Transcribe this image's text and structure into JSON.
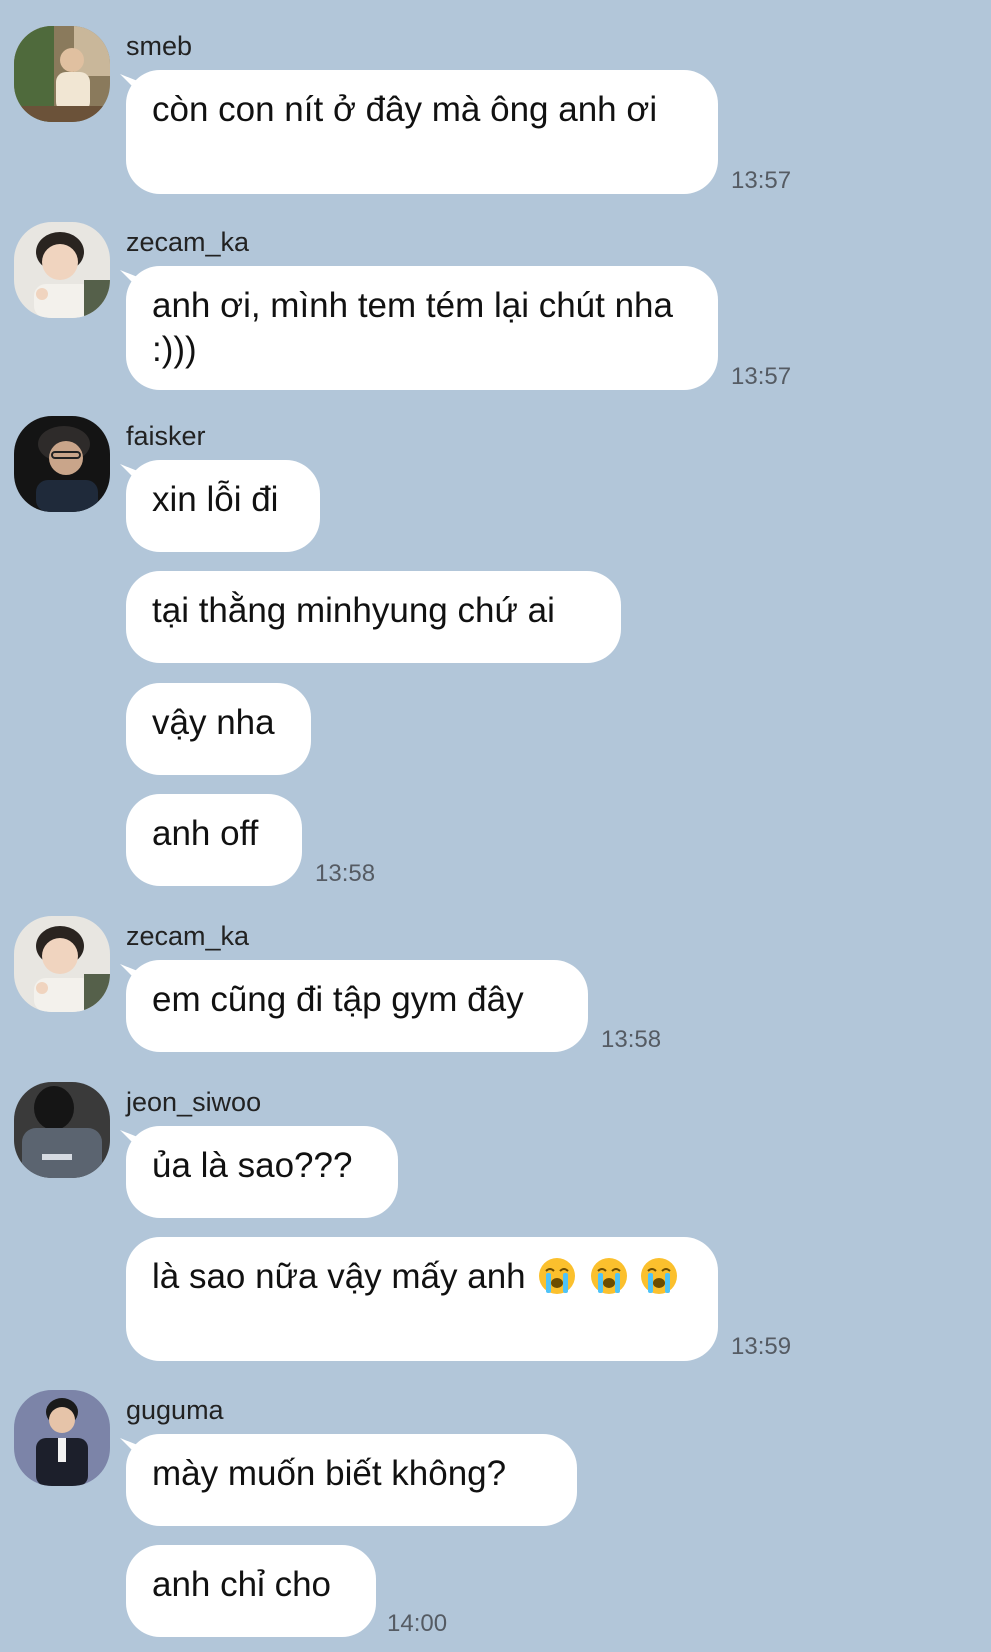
{
  "messages": [
    {
      "sender": "smeb",
      "bubbles": [
        "còn con nít ở đây mà ông anh ơi"
      ],
      "time": "13:57"
    },
    {
      "sender": "zecam_ka",
      "bubbles": [
        "anh ơi, mình tem tém lại chút nha :)))"
      ],
      "time": "13:57"
    },
    {
      "sender": "faisker",
      "bubbles": [
        "xin lỗi đi",
        "tại thằng minhyung chứ ai",
        "vậy nha",
        "anh off"
      ],
      "time": "13:58"
    },
    {
      "sender": "zecam_ka",
      "bubbles": [
        "em cũng đi tập gym đây"
      ],
      "time": "13:58"
    },
    {
      "sender": "jeon_siwoo",
      "bubbles": [
        "ủa là sao???",
        "là sao nữa vậy mấy anh"
      ],
      "time": "13:59"
    },
    {
      "sender": "guguma",
      "bubbles": [
        "mày muốn biết không?",
        "anh chỉ cho"
      ],
      "time": "14:00"
    }
  ],
  "icons": {
    "crying_emoji": "loudly-crying-face-icon"
  },
  "colors": {
    "background": "#b2c6d9",
    "bubble": "#ffffff",
    "timestamp": "#555b63"
  }
}
